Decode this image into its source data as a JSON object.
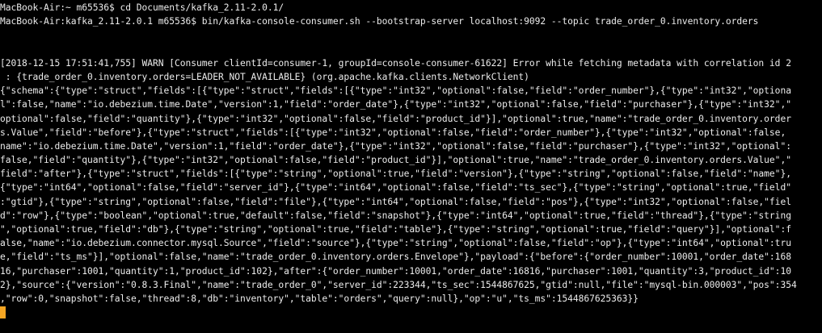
{
  "terminal": {
    "colors": {
      "background": "#000000",
      "foreground": "#ececec",
      "cursor": "#f5a623"
    },
    "lines": [
      "MacBook-Air:~ m65536$ cd Documents/kafka_2.11-2.0.1/",
      "MacBook-Air:kafka_2.11-2.0.1 m65536$ bin/kafka-console-consumer.sh --bootstrap-server localhost:9092 --topic trade_order_0.inventory.orders",
      "",
      "",
      "[2018-12-15 17:51:41,755] WARN [Consumer clientId=consumer-1, groupId=console-consumer-61622] Error while fetching metadata with correlation id 2",
      " : {trade_order_0.inventory.orders=LEADER_NOT_AVAILABLE} (org.apache.kafka.clients.NetworkClient)",
      "{\"schema\":{\"type\":\"struct\",\"fields\":[{\"type\":\"struct\",\"fields\":[{\"type\":\"int32\",\"optional\":false,\"field\":\"order_number\"},{\"type\":\"int32\",\"optiona",
      "l\":false,\"name\":\"io.debezium.time.Date\",\"version\":1,\"field\":\"order_date\"},{\"type\":\"int32\",\"optional\":false,\"field\":\"purchaser\"},{\"type\":\"int32\",\"",
      "optional\":false,\"field\":\"quantity\"},{\"type\":\"int32\",\"optional\":false,\"field\":\"product_id\"}],\"optional\":true,\"name\":\"trade_order_0.inventory.order",
      "s.Value\",\"field\":\"before\"},{\"type\":\"struct\",\"fields\":[{\"type\":\"int32\",\"optional\":false,\"field\":\"order_number\"},{\"type\":\"int32\",\"optional\":false,",
      "name\":\"io.debezium.time.Date\",\"version\":1,\"field\":\"order_date\"},{\"type\":\"int32\",\"optional\":false,\"field\":\"purchaser\"},{\"type\":\"int32\",\"optional\":",
      "false,\"field\":\"quantity\"},{\"type\":\"int32\",\"optional\":false,\"field\":\"product_id\"}],\"optional\":true,\"name\":\"trade_order_0.inventory.orders.Value\",\"",
      "field\":\"after\"},{\"type\":\"struct\",\"fields\":[{\"type\":\"string\",\"optional\":true,\"field\":\"version\"},{\"type\":\"string\",\"optional\":false,\"field\":\"name\"},",
      "{\"type\":\"int64\",\"optional\":false,\"field\":\"server_id\"},{\"type\":\"int64\",\"optional\":false,\"field\":\"ts_sec\"},{\"type\":\"string\",\"optional\":true,\"field\"",
      ":\"gtid\"},{\"type\":\"string\",\"optional\":false,\"field\":\"file\"},{\"type\":\"int64\",\"optional\":false,\"field\":\"pos\"},{\"type\":\"int32\",\"optional\":false,\"fiel",
      "d\":\"row\"},{\"type\":\"boolean\",\"optional\":true,\"default\":false,\"field\":\"snapshot\"},{\"type\":\"int64\",\"optional\":true,\"field\":\"thread\"},{\"type\":\"string",
      "\",\"optional\":true,\"field\":\"db\"},{\"type\":\"string\",\"optional\":true,\"field\":\"table\"},{\"type\":\"string\",\"optional\":true,\"field\":\"query\"}],\"optional\":f",
      "alse,\"name\":\"io.debezium.connector.mysql.Source\",\"field\":\"source\"},{\"type\":\"string\",\"optional\":false,\"field\":\"op\"},{\"type\":\"int64\",\"optional\":tru",
      "e,\"field\":\"ts_ms\"}],\"optional\":false,\"name\":\"trade_order_0.inventory.orders.Envelope\"},\"payload\":{\"before\":{\"order_number\":10001,\"order_date\":168",
      "16,\"purchaser\":1001,\"quantity\":1,\"product_id\":102},\"after\":{\"order_number\":10001,\"order_date\":16816,\"purchaser\":1001,\"quantity\":3,\"product_id\":10",
      "2},\"source\":{\"version\":\"0.8.3.Final\",\"name\":\"trade_order_0\",\"server_id\":223344,\"ts_sec\":1544867625,\"gtid\":null,\"file\":\"mysql-bin.000003\",\"pos\":354",
      ",\"row\":0,\"snapshot\":false,\"thread\":8,\"db\":\"inventory\",\"table\":\"orders\",\"query\":null},\"op\":\"u\",\"ts_ms\":1544867625363}}"
    ]
  }
}
